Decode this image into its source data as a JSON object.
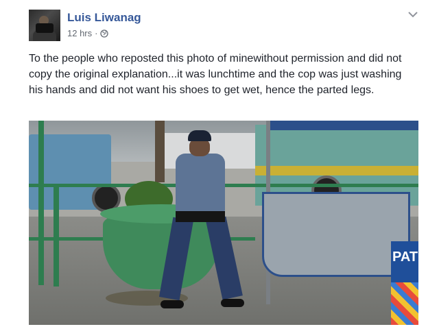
{
  "post": {
    "author_name": "Luis Liwanag",
    "timestamp": "12 hrs",
    "separator": "·",
    "privacy_icon": "globe-icon",
    "menu_icon": "chevron-down-icon",
    "text": "To the people who reposted this photo of minewithout permission and did not copy the original explanation...it was lunchtime and the cop was just washing his hands and did not want his shoes to get wet, hence the parted legs."
  },
  "photo": {
    "sign_text": "PATR"
  },
  "colors": {
    "author_link": "#365899",
    "meta_text": "#616770",
    "body_text": "#1d2129"
  }
}
